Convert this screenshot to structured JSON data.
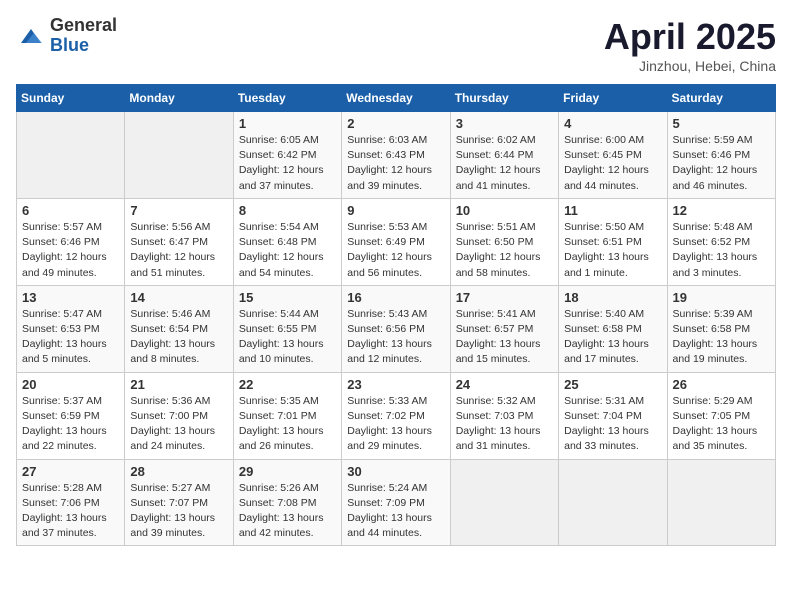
{
  "header": {
    "logo_general": "General",
    "logo_blue": "Blue",
    "month": "April 2025",
    "location": "Jinzhou, Hebei, China"
  },
  "days_of_week": [
    "Sunday",
    "Monday",
    "Tuesday",
    "Wednesday",
    "Thursday",
    "Friday",
    "Saturday"
  ],
  "weeks": [
    [
      {
        "day": "",
        "info": ""
      },
      {
        "day": "",
        "info": ""
      },
      {
        "day": "1",
        "info": "Sunrise: 6:05 AM\nSunset: 6:42 PM\nDaylight: 12 hours and 37 minutes."
      },
      {
        "day": "2",
        "info": "Sunrise: 6:03 AM\nSunset: 6:43 PM\nDaylight: 12 hours and 39 minutes."
      },
      {
        "day": "3",
        "info": "Sunrise: 6:02 AM\nSunset: 6:44 PM\nDaylight: 12 hours and 41 minutes."
      },
      {
        "day": "4",
        "info": "Sunrise: 6:00 AM\nSunset: 6:45 PM\nDaylight: 12 hours and 44 minutes."
      },
      {
        "day": "5",
        "info": "Sunrise: 5:59 AM\nSunset: 6:46 PM\nDaylight: 12 hours and 46 minutes."
      }
    ],
    [
      {
        "day": "6",
        "info": "Sunrise: 5:57 AM\nSunset: 6:46 PM\nDaylight: 12 hours and 49 minutes."
      },
      {
        "day": "7",
        "info": "Sunrise: 5:56 AM\nSunset: 6:47 PM\nDaylight: 12 hours and 51 minutes."
      },
      {
        "day": "8",
        "info": "Sunrise: 5:54 AM\nSunset: 6:48 PM\nDaylight: 12 hours and 54 minutes."
      },
      {
        "day": "9",
        "info": "Sunrise: 5:53 AM\nSunset: 6:49 PM\nDaylight: 12 hours and 56 minutes."
      },
      {
        "day": "10",
        "info": "Sunrise: 5:51 AM\nSunset: 6:50 PM\nDaylight: 12 hours and 58 minutes."
      },
      {
        "day": "11",
        "info": "Sunrise: 5:50 AM\nSunset: 6:51 PM\nDaylight: 13 hours and 1 minute."
      },
      {
        "day": "12",
        "info": "Sunrise: 5:48 AM\nSunset: 6:52 PM\nDaylight: 13 hours and 3 minutes."
      }
    ],
    [
      {
        "day": "13",
        "info": "Sunrise: 5:47 AM\nSunset: 6:53 PM\nDaylight: 13 hours and 5 minutes."
      },
      {
        "day": "14",
        "info": "Sunrise: 5:46 AM\nSunset: 6:54 PM\nDaylight: 13 hours and 8 minutes."
      },
      {
        "day": "15",
        "info": "Sunrise: 5:44 AM\nSunset: 6:55 PM\nDaylight: 13 hours and 10 minutes."
      },
      {
        "day": "16",
        "info": "Sunrise: 5:43 AM\nSunset: 6:56 PM\nDaylight: 13 hours and 12 minutes."
      },
      {
        "day": "17",
        "info": "Sunrise: 5:41 AM\nSunset: 6:57 PM\nDaylight: 13 hours and 15 minutes."
      },
      {
        "day": "18",
        "info": "Sunrise: 5:40 AM\nSunset: 6:58 PM\nDaylight: 13 hours and 17 minutes."
      },
      {
        "day": "19",
        "info": "Sunrise: 5:39 AM\nSunset: 6:58 PM\nDaylight: 13 hours and 19 minutes."
      }
    ],
    [
      {
        "day": "20",
        "info": "Sunrise: 5:37 AM\nSunset: 6:59 PM\nDaylight: 13 hours and 22 minutes."
      },
      {
        "day": "21",
        "info": "Sunrise: 5:36 AM\nSunset: 7:00 PM\nDaylight: 13 hours and 24 minutes."
      },
      {
        "day": "22",
        "info": "Sunrise: 5:35 AM\nSunset: 7:01 PM\nDaylight: 13 hours and 26 minutes."
      },
      {
        "day": "23",
        "info": "Sunrise: 5:33 AM\nSunset: 7:02 PM\nDaylight: 13 hours and 29 minutes."
      },
      {
        "day": "24",
        "info": "Sunrise: 5:32 AM\nSunset: 7:03 PM\nDaylight: 13 hours and 31 minutes."
      },
      {
        "day": "25",
        "info": "Sunrise: 5:31 AM\nSunset: 7:04 PM\nDaylight: 13 hours and 33 minutes."
      },
      {
        "day": "26",
        "info": "Sunrise: 5:29 AM\nSunset: 7:05 PM\nDaylight: 13 hours and 35 minutes."
      }
    ],
    [
      {
        "day": "27",
        "info": "Sunrise: 5:28 AM\nSunset: 7:06 PM\nDaylight: 13 hours and 37 minutes."
      },
      {
        "day": "28",
        "info": "Sunrise: 5:27 AM\nSunset: 7:07 PM\nDaylight: 13 hours and 39 minutes."
      },
      {
        "day": "29",
        "info": "Sunrise: 5:26 AM\nSunset: 7:08 PM\nDaylight: 13 hours and 42 minutes."
      },
      {
        "day": "30",
        "info": "Sunrise: 5:24 AM\nSunset: 7:09 PM\nDaylight: 13 hours and 44 minutes."
      },
      {
        "day": "",
        "info": ""
      },
      {
        "day": "",
        "info": ""
      },
      {
        "day": "",
        "info": ""
      }
    ]
  ]
}
